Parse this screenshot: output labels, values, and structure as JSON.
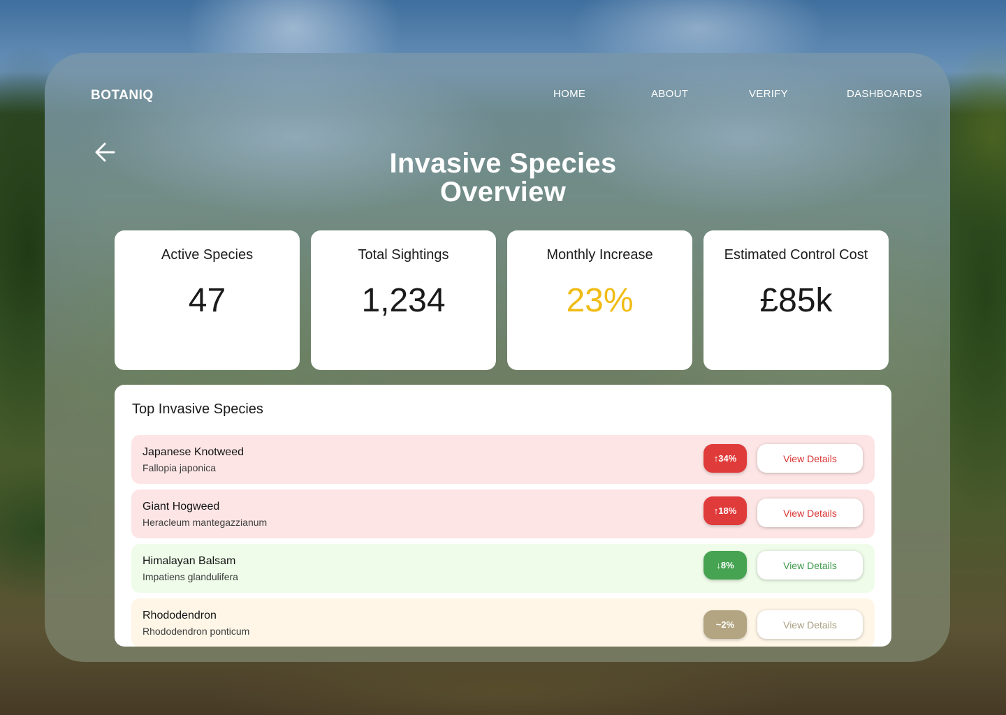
{
  "header": {
    "brand": "BOTANIQ",
    "nav": [
      "HOME",
      "ABOUT",
      "VERIFY",
      "DASHBOARDS"
    ]
  },
  "page": {
    "back_icon": "arrow-left-icon",
    "title_line1": "Invasive Species",
    "title_line2": "Overview"
  },
  "stats": [
    {
      "label": "Active Species",
      "value": "47"
    },
    {
      "label": "Total Sightings",
      "value": "1,234"
    },
    {
      "label": "Monthly Increase",
      "value": "23%",
      "color": "#f0bc14"
    },
    {
      "label": "Estimated Control Cost",
      "value": "£85k"
    }
  ],
  "top_species": {
    "title": "Top Invasive Species",
    "rows": [
      {
        "name": "Japanese Knotweed",
        "scientific": "Fallopia japonica",
        "trend": "↑34%",
        "button": "View Details",
        "row_color": "#fde5e5",
        "badge_color": "#e03b3b",
        "button_text_color": "#d93535"
      },
      {
        "name": "Giant Hogweed",
        "scientific": "Heracleum mantegazzianum",
        "trend": "↑18%",
        "button": "View Details",
        "row_color": "#fde5e5",
        "badge_color": "#e03b3b",
        "button_text_color": "#d93535"
      },
      {
        "name": "Himalayan Balsam",
        "scientific": "Impatiens glandulifera",
        "trend": "↓8%",
        "button": "View Details",
        "row_color": "#effcea",
        "badge_color": "#46a352",
        "button_text_color": "#3e9b4c"
      },
      {
        "name": "Rhododendron",
        "scientific": "Rhododendron ponticum",
        "trend": "~2%",
        "button": "View Details",
        "row_color": "#fff6e7",
        "badge_color": "#b3a582",
        "button_text_color": "#aa9f80"
      }
    ]
  }
}
